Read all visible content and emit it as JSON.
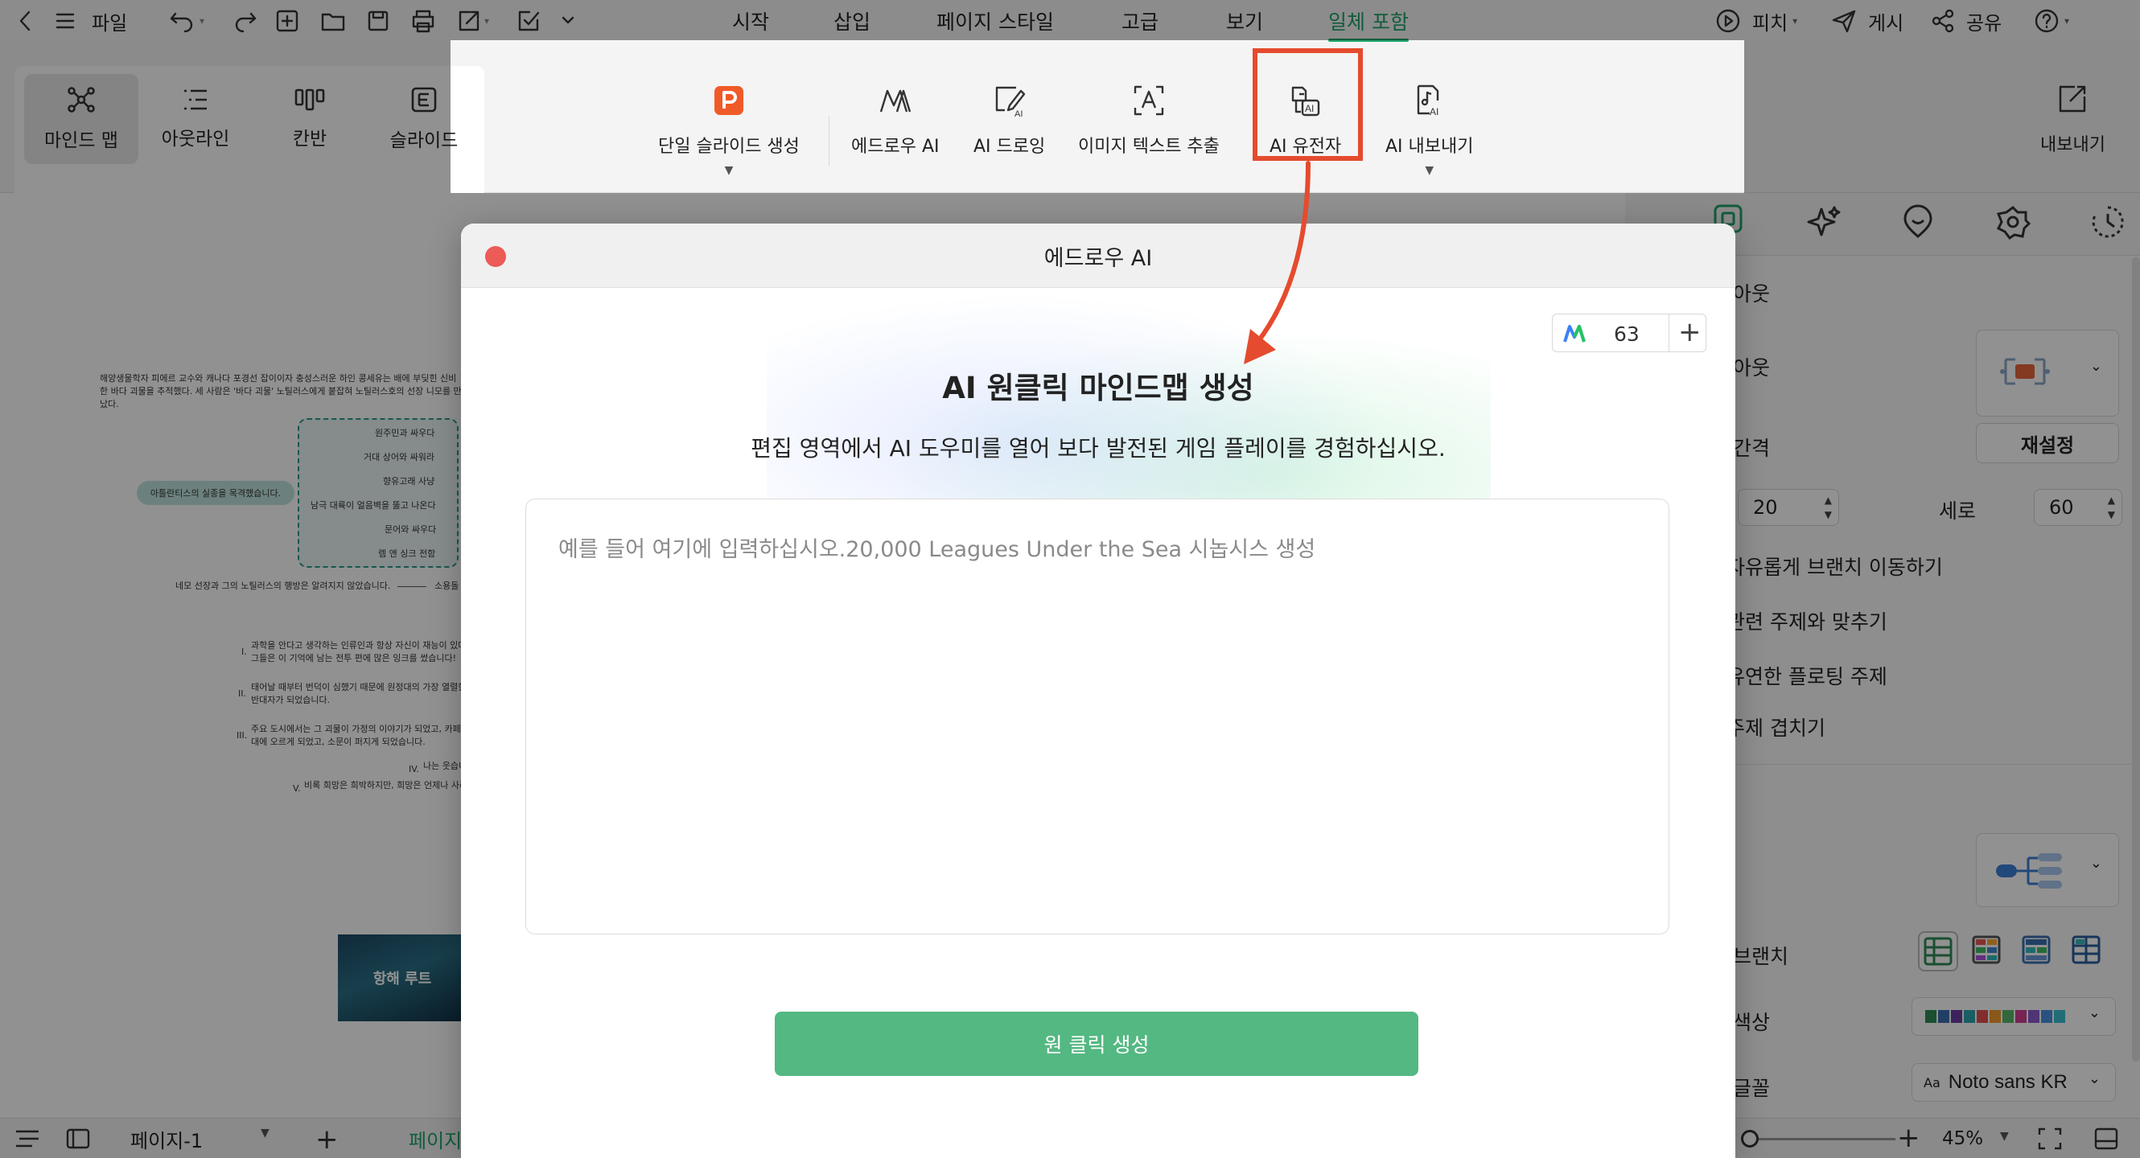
{
  "topbar": {
    "file_label": "파일",
    "menu_tabs": [
      "시작",
      "삽입",
      "페이지 스타일",
      "고급",
      "보기",
      "일체 포함"
    ],
    "active_tab_index": 5,
    "pitch_label": "피치",
    "publish_label": "게시",
    "share_label": "공유",
    "help_label": "?"
  },
  "view_switch": {
    "items": [
      {
        "label": "마인드 맵",
        "icon": "mindmap-icon",
        "active": true
      },
      {
        "label": "아웃라인",
        "icon": "outline-icon",
        "active": false
      },
      {
        "label": "칸반",
        "icon": "kanban-icon",
        "active": false
      },
      {
        "label": "슬라이드",
        "icon": "slide-icon",
        "active": false
      }
    ]
  },
  "ai_toolbar": {
    "items": [
      {
        "label": "단일 슬라이드 생성",
        "icon": "ppt-icon",
        "has_dropdown": true
      },
      {
        "label": "에드로우 AI",
        "icon": "edraw-ai-icon",
        "has_dropdown": false
      },
      {
        "label": "AI 드로잉",
        "icon": "ai-drawing-icon",
        "has_dropdown": false
      },
      {
        "label": "이미지 텍스트 추출",
        "icon": "text-extract-icon",
        "has_dropdown": false
      },
      {
        "label": "AI 유전자",
        "icon": "ai-gene-icon",
        "has_dropdown": false
      },
      {
        "label": "AI 내보내기",
        "icon": "ai-export-icon",
        "has_dropdown": true
      }
    ],
    "highlighted_index": 4,
    "export_label": "내보내기"
  },
  "canvas": {
    "intro_text": [
      "해양생물학자 피에르 교수와 캐나다 포경선 잡이이자 충성스러운 하인 콩세유는 배에 부딪힌 신비",
      "한 바다 괴물을 추적했다. 세 사람은 '바다 괴물' 노틸러스에게 붙잡혀 노틸러스호의 선장 니모를 만",
      "났다."
    ],
    "center_node": "아틀란티스의 실종을 목격했습니다.",
    "branch_items": [
      "원주민과 싸우다",
      "거대 상어와 싸워라",
      "향유고래 사냥",
      "남극 대륙이 얼음벽을 뚫고 나온다",
      "문어와 싸우다",
      "렘 앤 싱크 전함"
    ],
    "after_text": "네모 선장과 그의 노틸러스의 행방은 알려지지 않았습니다.",
    "after_right": "소용돌",
    "list_items": [
      {
        "num": "I.",
        "lines": [
          "과학을 안다고 생각하는 인류인과 항상 자신이 재능이 있다",
          "그들은 이 기억에 남는 전투 편에 많은 잉크를 썼습니다!"
        ]
      },
      {
        "num": "II.",
        "lines": [
          "태어날 때부터 번덕이 심했기 때문에 원정대의 가장 열렬한",
          "반대자가 되었습니다."
        ]
      },
      {
        "num": "III.",
        "lines": [
          "주요 도시에서는 그 괴물이 가정의 이야기가 되었고, 카페",
          "대에 오르게 되었고, 소문이 퍼지게 되었습니다."
        ]
      },
      {
        "num": "IV.",
        "lines": [
          "나는 웃습니"
        ]
      },
      {
        "num": "V.",
        "lines": [
          "비록 희망은 희박하지만, 희망은 언제나 사라"
        ]
      }
    ],
    "image_label": "항해 루트"
  },
  "modal": {
    "title": "에드로우 AI",
    "credits": "63",
    "heading": "AI 원클릭 마인드맵 생성",
    "subtitle": "편집 영역에서 AI 도우미를 열어 보다 발전된 게임 플레이를 경험하십시오.",
    "placeholder": "예를 들어 여기에 입력하십시오.20,000 Leagues Under the Sea 시놉시스 생성",
    "generate_label": "원 클릭 생성"
  },
  "right_panel": {
    "tabs": [
      "layout-icon",
      "ai-sparkle-icon",
      "location-icon",
      "gear-flower-icon",
      "clock-icon"
    ],
    "layout_label": "아웃",
    "layout2_label": "아웃",
    "spacing_label": "간격",
    "reset_label": "재설정",
    "horizontal_value": "20",
    "vertical_label": "세로",
    "vertical_value": "60",
    "options": [
      "자유롭게 브랜치 이동하기",
      "관련 주제와 맞추기",
      "유연한 플로팅 주제",
      "주제 겹치기"
    ],
    "branch_label": "브랜치",
    "color_label": "색상",
    "font_label": "글꼴",
    "font_prefix": "Aa",
    "font_value": "Noto sans KR"
  },
  "bottombar": {
    "page_label": "페이지-1",
    "page_tab": "페이지",
    "zoom": "45%"
  },
  "colors": {
    "accent_green": "#20a36a",
    "button_green": "#54b882",
    "highlight_red": "#e54b2e",
    "close_red": "#ec5b55"
  }
}
